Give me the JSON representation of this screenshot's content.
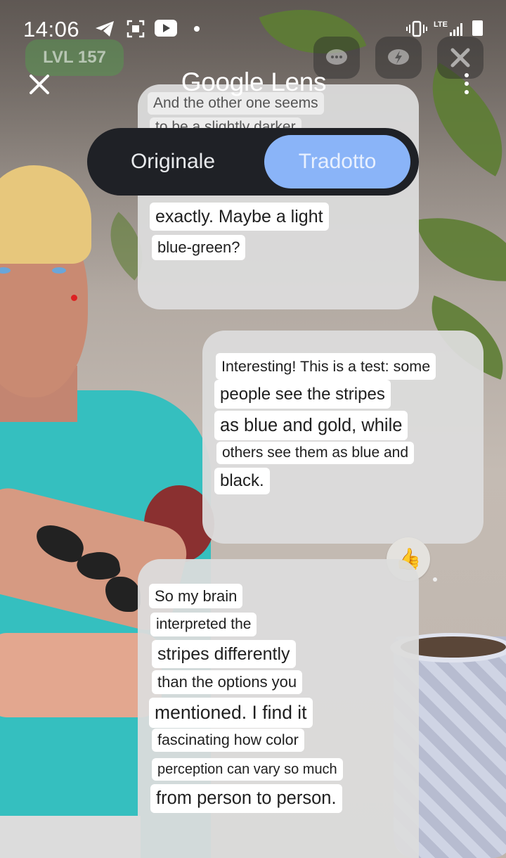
{
  "status_bar": {
    "time": "14:06",
    "network": "LTE",
    "icons": [
      "telegram-icon",
      "scan-icon",
      "youtube-icon",
      "dot-icon",
      "vibrate-icon",
      "signal-icon",
      "battery-icon"
    ]
  },
  "game_overlay": {
    "level_label": "LVL 157",
    "buttons": [
      "chat-bubble-icon",
      "lightning-chat-icon",
      "close-icon"
    ]
  },
  "lens": {
    "title": "Google Lens",
    "toggle": {
      "original_label": "Originale",
      "translated_label": "Tradotto",
      "selected": "Tradotto"
    }
  },
  "messages": {
    "bubble1": {
      "line1": "And the other one seems",
      "line2": "to be a slightly darker",
      "line3": "exactly. Maybe a light",
      "line4": "blue-green?"
    },
    "bubble2": {
      "line1": "Interesting! This is a test: some",
      "line2": "people see the stripes",
      "line3": "as blue and gold, while",
      "line4": "others see them as blue and",
      "line5": "black."
    },
    "bubble3": {
      "line1": "So my brain",
      "line2": "interpreted the",
      "line3": "stripes differently",
      "line4": "than the options you",
      "line5": "mentioned. I find it",
      "line6": "fascinating how color",
      "line7": "perception can vary so much",
      "line8": "from person to person."
    },
    "reaction": "👍"
  },
  "colors": {
    "toggle_bg": "#1f2126",
    "toggle_selected": "#8ab4f8",
    "bubble_bg": "#dcdcdc"
  }
}
